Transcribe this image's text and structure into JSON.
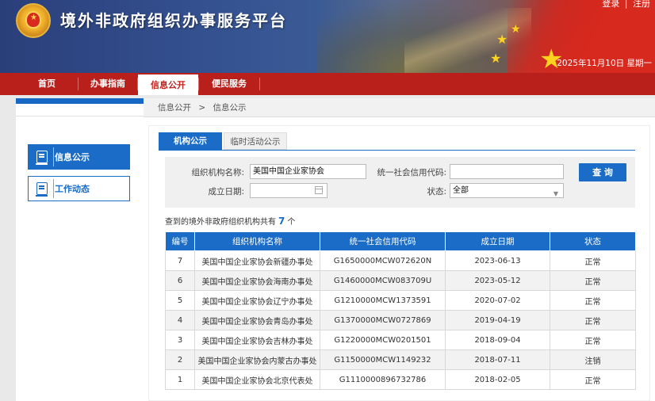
{
  "header": {
    "site_title": "境外非政府组织办事服务平台",
    "login_label": "登录",
    "separator": "|",
    "register_label": "注册",
    "date": "2025年11月10日 星期一"
  },
  "nav": {
    "items": [
      {
        "label": "首页"
      },
      {
        "label": "办事指南"
      },
      {
        "label": "信息公开"
      },
      {
        "label": "便民服务"
      }
    ],
    "active_index": 2
  },
  "sidebar": {
    "items": [
      {
        "label": "信息公示",
        "active": true
      },
      {
        "label": "工作动态",
        "active": false
      }
    ]
  },
  "breadcrumb": {
    "level1": "信息公开",
    "separator": ">",
    "level2": "信息公示"
  },
  "tabs": [
    {
      "label": "机构公示"
    },
    {
      "label": "临时活动公示"
    }
  ],
  "search": {
    "org_name_label": "组织机构名称:",
    "org_name_value": "美国中国企业家协会",
    "credit_code_label": "统一社会信用代码:",
    "credit_code_value": "",
    "date_label": "成立日期:",
    "date_value": "",
    "status_label": "状态:",
    "status_value": "全部",
    "query_button": "查 询"
  },
  "result": {
    "prefix": "查到的境外非政府组织机构共有",
    "count": "7",
    "suffix": "个"
  },
  "table": {
    "headers": [
      "编号",
      "组织机构名称",
      "统一社会信用代码",
      "成立日期",
      "状态"
    ],
    "rows": [
      [
        "7",
        "美国中国企业家协会新疆办事处",
        "G1650000MCW072620N",
        "2023-06-13",
        "正常"
      ],
      [
        "6",
        "美国中国企业家协会海南办事处",
        "G1460000MCW083709U",
        "2023-05-12",
        "正常"
      ],
      [
        "5",
        "美国中国企业家协会辽宁办事处",
        "G1210000MCW1373591",
        "2020-07-02",
        "正常"
      ],
      [
        "4",
        "美国中国企业家协会青岛办事处",
        "G1370000MCW0727869",
        "2019-04-19",
        "正常"
      ],
      [
        "3",
        "美国中国企业家协会吉林办事处",
        "G1220000MCW0201501",
        "2018-09-04",
        "正常"
      ],
      [
        "2",
        "美国中国企业家协会内蒙古办事处",
        "G1150000MCW1149232",
        "2018-07-11",
        "注销"
      ],
      [
        "1",
        "美国中国企业家协会北京代表处",
        "G1110000896732786",
        "2018-02-05",
        "正常"
      ]
    ]
  },
  "colors": {
    "primary_blue": "#1a6cc6",
    "nav_red": "#b9201c"
  }
}
